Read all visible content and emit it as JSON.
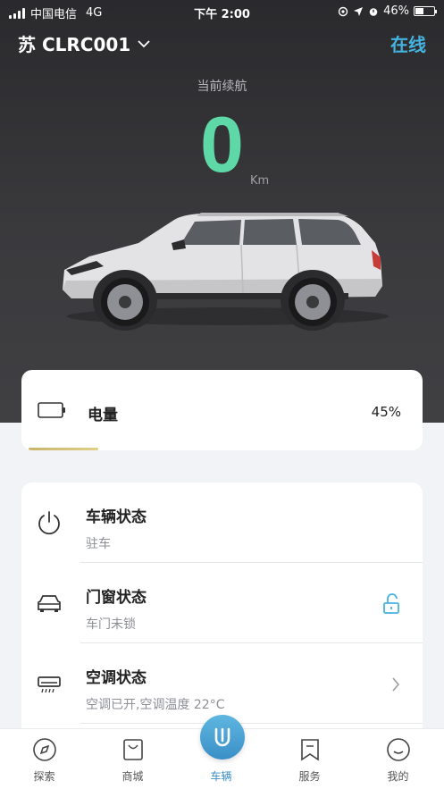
{
  "status_bar": {
    "carrier": "中国电信",
    "network": "4G",
    "time": "下午 2:00",
    "battery_percent": "46%",
    "battery_level": 0.46
  },
  "header": {
    "vehicle_name": "苏 CLRC001",
    "connection_status": "在线"
  },
  "range": {
    "label": "当前续航",
    "value": "0",
    "unit": "Km"
  },
  "battery": {
    "title": "电量",
    "value": "45%",
    "level": 0.45
  },
  "status_items": [
    {
      "title": "车辆状态",
      "subtitle": "驻车",
      "icon": "power-icon"
    },
    {
      "title": "门窗状态",
      "subtitle": "车门未锁",
      "icon": "car-front-icon",
      "right_icon": "unlock-icon"
    },
    {
      "title": "空调状态",
      "subtitle": "空调已开,空调温度 22°C",
      "icon": "air-conditioner-icon",
      "right_icon": "chevron-right-icon"
    }
  ],
  "bottom_nav": [
    {
      "label": "探索",
      "icon": "compass-icon"
    },
    {
      "label": "商城",
      "icon": "shopping-bag-icon"
    },
    {
      "label": "车辆",
      "icon": "vehicle-logo-icon",
      "active": true
    },
    {
      "label": "服务",
      "icon": "bookmark-icon"
    },
    {
      "label": "我的",
      "icon": "smile-icon"
    }
  ],
  "colors": {
    "accent": "#45b3e0",
    "range_value": "#5fd8a8",
    "battery_bar": "#d4c27a",
    "nav_active": "#3a8fc7"
  }
}
